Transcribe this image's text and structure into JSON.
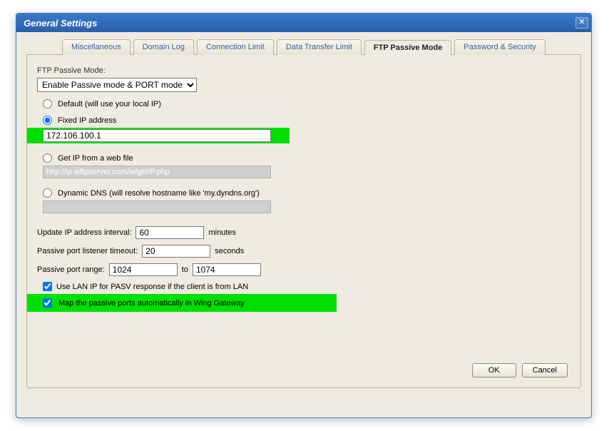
{
  "title": "General Settings",
  "tabs": {
    "miscellaneous": "Miscellaneous",
    "domain_log": "Domain Log",
    "connection_limit": "Connection Limit",
    "data_transfer_limit": "Data Transfer Limit",
    "ftp_passive_mode": "FTP Passive Mode",
    "password_security": "Password & Security"
  },
  "panel": {
    "mode_label": "FTP Passive Mode:",
    "mode_value": "Enable Passive mode & PORT mode",
    "radio_default": "Default (will use your local IP)",
    "radio_fixed": "Fixed IP address",
    "fixed_ip_value": "172.106.100.1",
    "radio_webfile": "Get IP from a web file",
    "webfile_value": "http://ip.wftpserver.com/w/getIP.php",
    "radio_dyndns": "Dynamic DNS (will resolve hostname like 'my.dyndns.org')",
    "update_interval_label": "Update IP address interval:",
    "update_interval_value": "60",
    "update_interval_unit": "minutes",
    "listener_timeout_label": "Passive port listener timeout:",
    "listener_timeout_value": "20",
    "listener_timeout_unit": "seconds",
    "port_range_label": "Passive port range:",
    "port_range_from": "1024",
    "port_range_to_label": "to",
    "port_range_to": "1074",
    "use_lan_ip": "Use LAN IP for PASV response if the client is from LAN",
    "map_wing": "Map the passive ports automatically in Wing Gateway"
  },
  "buttons": {
    "ok": "OK",
    "cancel": "Cancel"
  }
}
